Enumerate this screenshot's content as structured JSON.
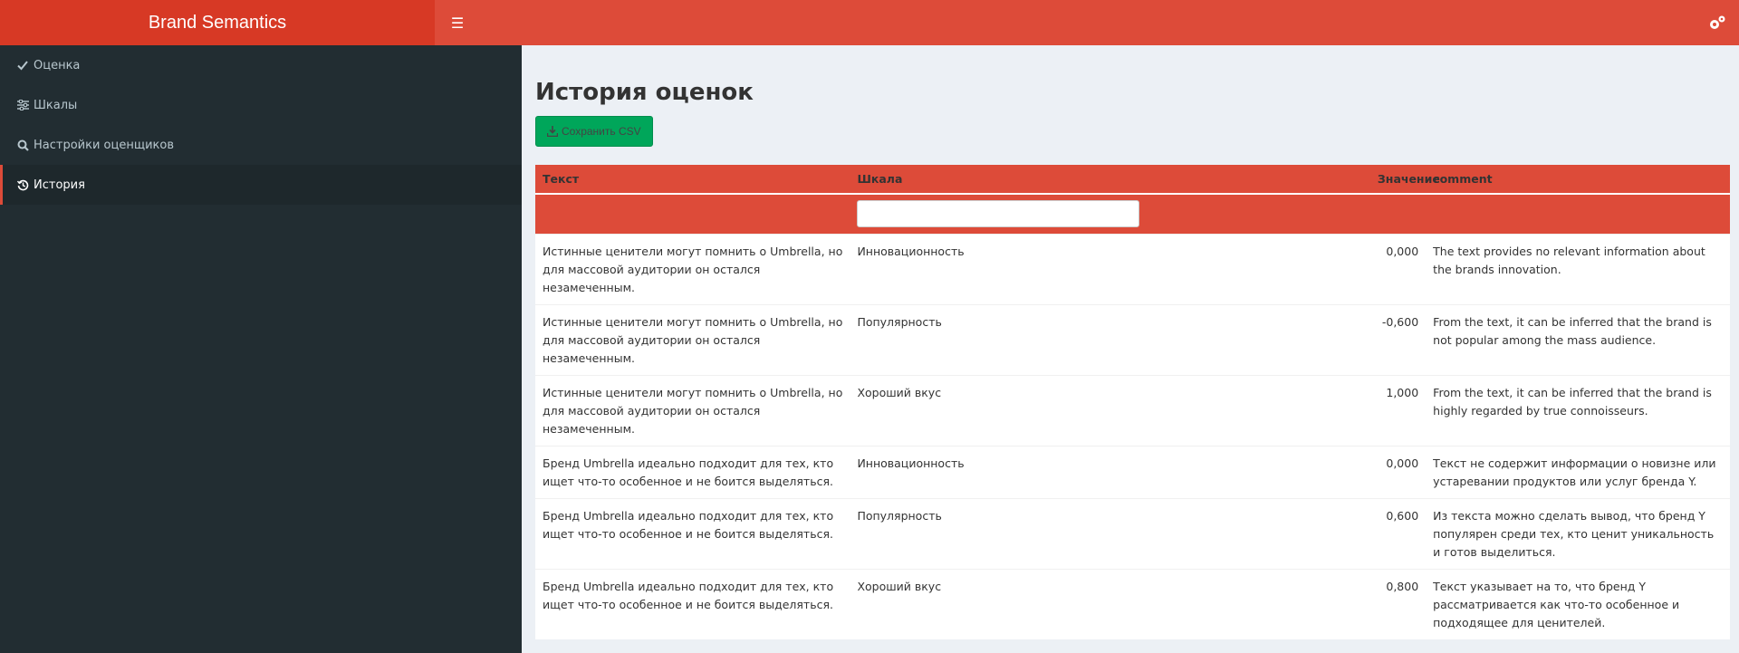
{
  "header": {
    "app_title": "Brand Semantics"
  },
  "sidebar": {
    "items": [
      {
        "label": "Оценка",
        "icon": "check-icon"
      },
      {
        "label": "Шкалы",
        "icon": "sliders-icon"
      },
      {
        "label": "Настройки оценщиков",
        "icon": "search-icon"
      },
      {
        "label": "История",
        "icon": "history-icon",
        "active": true
      }
    ]
  },
  "main": {
    "title": "История оценок",
    "csv_button_label": "Сохранить CSV"
  },
  "table": {
    "columns": [
      "Текст",
      "Шкала",
      "Значение",
      "comment"
    ],
    "rows": [
      {
        "text": "Истинные ценители могут помнить о Umbrella, но для массовой аудитории он остался незамеченным.",
        "scale": "Инновационность",
        "value": "0,000",
        "comment": "The text provides no relevant information about the brands innovation."
      },
      {
        "text": "Истинные ценители могут помнить о Umbrella, но для массовой аудитории он остался незамеченным.",
        "scale": "Популярность",
        "value": "-0,600",
        "comment": "From the text, it can be inferred that the brand is not popular among the mass audience."
      },
      {
        "text": "Истинные ценители могут помнить о Umbrella, но для массовой аудитории он остался незамеченным.",
        "scale": "Хороший вкус",
        "value": "1,000",
        "comment": "From the text, it can be inferred that the brand is highly regarded by true connoisseurs."
      },
      {
        "text": "Бренд Umbrella идеально подходит для тех, кто ищет что-то особенное и не боится выделяться.",
        "scale": "Инновационность",
        "value": "0,000",
        "comment": "Текст не содержит информации о новизне или устаревании продуктов или услуг бренда Y."
      },
      {
        "text": "Бренд Umbrella идеально подходит для тех, кто ищет что-то особенное и не боится выделяться.",
        "scale": "Популярность",
        "value": "0,600",
        "comment": "Из текста можно сделать вывод, что бренд Y популярен среди тех, кто ценит уникальность и готов выделиться."
      },
      {
        "text": "Бренд Umbrella идеально подходит для тех, кто ищет что-то особенное и не боится выделяться.",
        "scale": "Хороший вкус",
        "value": "0,800",
        "comment": "Текст указывает на то, что бренд Y рассматривается как что-то особенное и подходящее для ценителей."
      }
    ]
  },
  "colors": {
    "header_logo": "#d73925",
    "header_bar": "#dd4b39",
    "sidebar_bg": "#222d32",
    "sidebar_active": "#1e282c",
    "button_green": "#00a65a",
    "content_bg": "#ecf0f5"
  }
}
